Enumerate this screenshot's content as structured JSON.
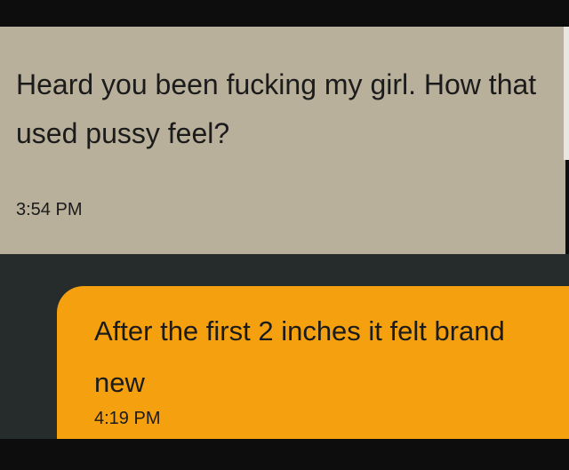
{
  "messages": {
    "incoming": {
      "text": "Heard you been fucking my girl. How that used pussy feel?",
      "time": "3:54 PM"
    },
    "outgoing": {
      "text": "After the first 2 inches it felt brand new",
      "time": "4:19 PM"
    }
  },
  "colors": {
    "incoming_bubble": "#b9b09b",
    "outgoing_bubble": "#f5a10f",
    "conversation_background": "#262b2c",
    "text": "#1b1b1b"
  }
}
